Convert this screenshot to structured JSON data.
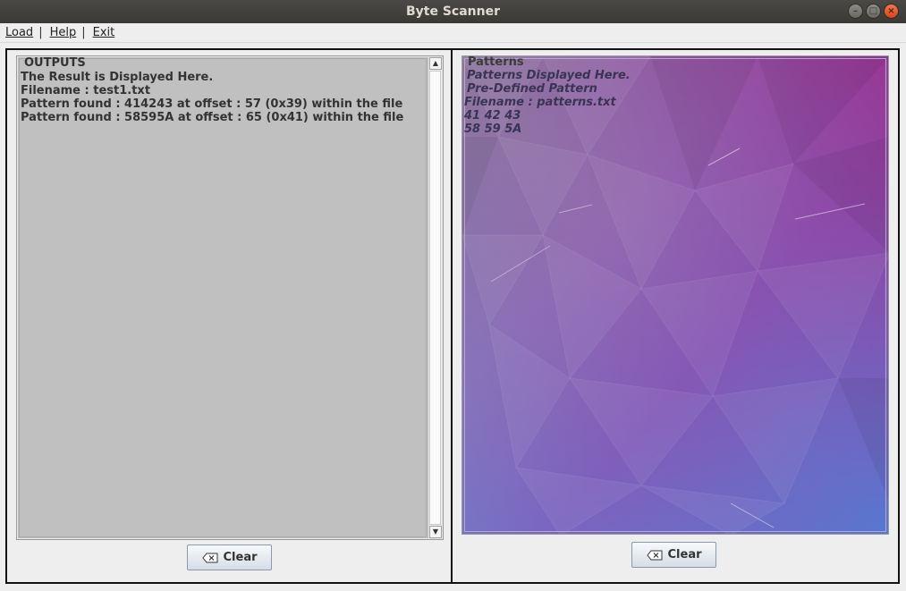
{
  "window": {
    "title": "Byte Scanner",
    "controls": [
      "–",
      "□",
      "×"
    ]
  },
  "menu": {
    "items": [
      {
        "label": "Load"
      },
      {
        "label": "Help"
      },
      {
        "label": "Exit"
      }
    ]
  },
  "outputs": {
    "title": "OUTPUTS",
    "lines": [
      "The Result is Displayed Here.",
      "Filename : test1.txt",
      "Pattern found : 414243 at offset : 57 (0x39) within the file",
      "Pattern found : 58595A at offset : 65 (0x41) within the file"
    ],
    "clear_label": "Clear"
  },
  "patterns": {
    "title": "Patterns",
    "lines": [
      " Patterns Displayed Here.",
      " Pre-Defined Pattern",
      "Filename : patterns.txt",
      "41 42 43",
      "58 59 5A"
    ],
    "clear_label": "Clear",
    "background_colors": [
      "#8a7f9c",
      "#9b6fb5",
      "#7a5aa8",
      "#a14ea6",
      "#6e7fd0",
      "#4f86d9"
    ]
  }
}
